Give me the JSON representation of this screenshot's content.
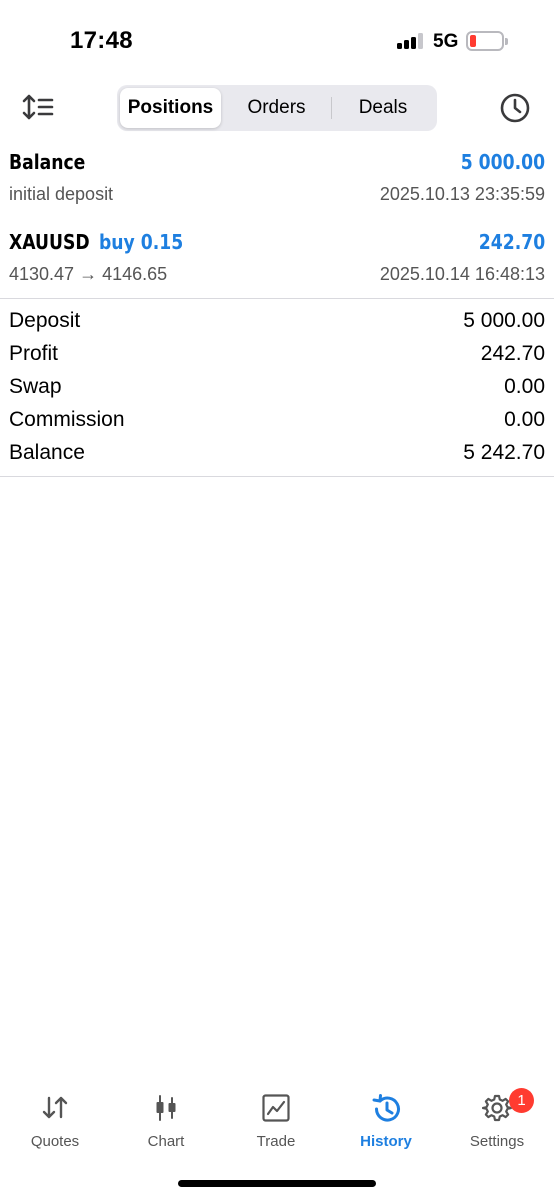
{
  "status_bar": {
    "time": "17:48",
    "network": "5G"
  },
  "toolbar": {
    "tabs": [
      {
        "label": "Positions",
        "active": true
      },
      {
        "label": "Orders",
        "active": false
      },
      {
        "label": "Deals",
        "active": false
      }
    ],
    "icons": {
      "left": "sort-icon",
      "right": "clock-icon"
    }
  },
  "deals": [
    {
      "title": "Balance",
      "value": "5 000.00",
      "subtitle": "initial deposit",
      "time": "2025.10.13 23:35:59"
    },
    {
      "symbol": "XAUUSD",
      "side": "buy 0.15",
      "value": "242.70",
      "prices": "4130.47 → 4146.65",
      "time": "2025.10.14 16:48:13"
    }
  ],
  "summary": [
    {
      "label": "Deposit",
      "value": "5 000.00"
    },
    {
      "label": "Profit",
      "value": "242.70"
    },
    {
      "label": "Swap",
      "value": "0.00"
    },
    {
      "label": "Commission",
      "value": "0.00"
    },
    {
      "label": "Balance",
      "value": "5 242.70"
    }
  ],
  "tabbar": {
    "items": [
      {
        "label": "Quotes",
        "icon": "quotes-icon"
      },
      {
        "label": "Chart",
        "icon": "chart-icon"
      },
      {
        "label": "Trade",
        "icon": "trade-icon"
      },
      {
        "label": "History",
        "icon": "history-icon",
        "active": true
      },
      {
        "label": "Settings",
        "icon": "settings-icon"
      }
    ],
    "settings_badge": "1"
  },
  "colors": {
    "accent": "#1e7fe0",
    "badge": "#ff3b30"
  }
}
